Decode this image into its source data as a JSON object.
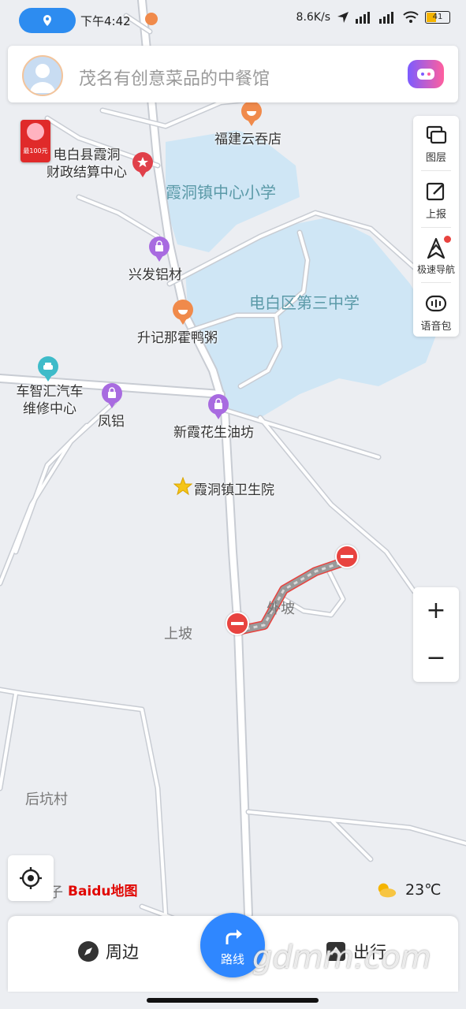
{
  "status_bar": {
    "time": "下午4:42",
    "net_speed": "8.6K/s",
    "battery": "41"
  },
  "search": {
    "placeholder": "茂名有创意菜品的中餐馆"
  },
  "promo": {
    "text": "最100元"
  },
  "toolbar": {
    "layers": "图层",
    "report": "上报",
    "fast_nav": "极速导航",
    "voice_pack": "语音包"
  },
  "zoom": {
    "in": "+",
    "out": "−"
  },
  "map": {
    "areas": [
      {
        "name": "霞洞镇中心小学"
      },
      {
        "name": "电白区第三中学"
      }
    ],
    "pois": [
      {
        "name": "福建云吞店",
        "icon": "food-icon"
      },
      {
        "name": "电白县霞洞\n财政结算中心",
        "icon": "star-icon"
      },
      {
        "name": "兴发铝材",
        "icon": "shop-icon"
      },
      {
        "name": "升记那霍鸭粥",
        "icon": "food-icon"
      },
      {
        "name": "车智汇汽车\n维修中心",
        "icon": "car-icon"
      },
      {
        "name": "凤铝",
        "icon": "shop-icon"
      },
      {
        "name": "新霞花生油坊",
        "icon": "shop-icon"
      },
      {
        "name": "霞洞镇卫生院",
        "icon": "star-icon"
      }
    ],
    "villages": [
      {
        "name": "外坡"
      },
      {
        "name": "上坡"
      },
      {
        "name": "后坑村"
      },
      {
        "name": "子"
      }
    ]
  },
  "logo": {
    "text": "Baidu地图"
  },
  "weather": {
    "temp": "23℃",
    "icon": "cloudy-icon"
  },
  "bottom_bar": {
    "nearby": "周边",
    "route": "路线",
    "travel": "出行"
  },
  "watermark": "gdmm.com",
  "colors": {
    "accent": "#2f87ff",
    "road_block": "#e8433f",
    "water_area": "#cfe6f5",
    "road": "#ffffff"
  }
}
